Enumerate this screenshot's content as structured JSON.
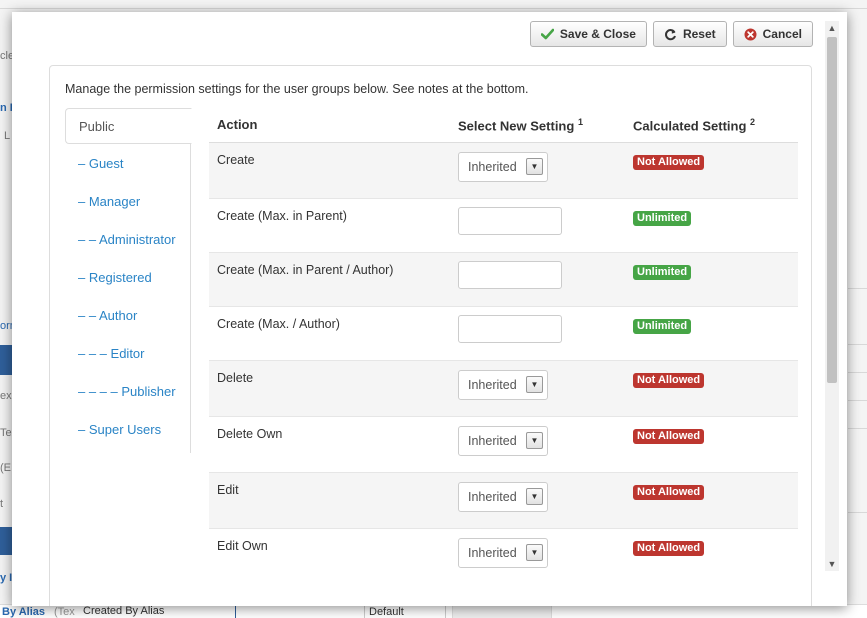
{
  "background": {
    "fragments": [
      "cle",
      "n F",
      "L",
      "orm",
      "ex",
      "Tex",
      "(E",
      "t",
      "y I"
    ],
    "bottom_row": {
      "col1": "By Alias",
      "col2": "(Tex",
      "col3": "Created By Alias",
      "col4": "Default"
    }
  },
  "toolbar": {
    "save_close_label": "Save & Close",
    "reset_label": "Reset",
    "cancel_label": "Cancel"
  },
  "panel": {
    "intro": "Manage the permission settings for the user groups below. See notes at the bottom."
  },
  "groups": [
    {
      "label": "Public"
    },
    {
      "label": "– Guest"
    },
    {
      "label": "– Manager"
    },
    {
      "label": "– – Administrator"
    },
    {
      "label": "– Registered"
    },
    {
      "label": "– – Author"
    },
    {
      "label": "– – – Editor"
    },
    {
      "label": "– – – – Publisher"
    },
    {
      "label": "– Super Users"
    }
  ],
  "table": {
    "headers": {
      "action": "Action",
      "select": "Select New Setting",
      "select_note": "1",
      "calculated": "Calculated Setting",
      "calculated_note": "2"
    },
    "rows": [
      {
        "action": "Create",
        "setting": "Inherited",
        "calculated": "Not Allowed"
      },
      {
        "action": "Create (Max. in Parent)",
        "setting": "",
        "calculated": "Unlimited"
      },
      {
        "action": "Create (Max. in Parent / Author)",
        "setting": "",
        "calculated": "Unlimited"
      },
      {
        "action": "Create (Max. / Author)",
        "setting": "",
        "calculated": "Unlimited"
      },
      {
        "action": "Delete",
        "setting": "Inherited",
        "calculated": "Not Allowed"
      },
      {
        "action": "Delete Own",
        "setting": "Inherited",
        "calculated": "Not Allowed"
      },
      {
        "action": "Edit",
        "setting": "Inherited",
        "calculated": "Not Allowed"
      },
      {
        "action": "Edit Own",
        "setting": "Inherited",
        "calculated": "Not Allowed"
      }
    ]
  },
  "colors": {
    "link": "#2a84c6",
    "danger": "#bd362f",
    "success": "#46a546",
    "save_icon": "#46a546",
    "cancel_icon": "#bd362f"
  }
}
